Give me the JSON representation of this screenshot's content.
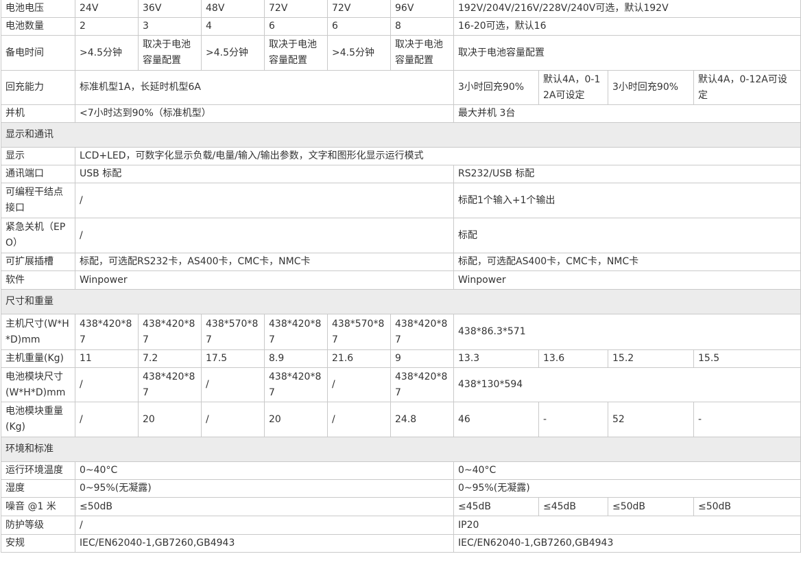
{
  "rows": [
    {
      "cells": [
        "电池电压",
        "24V",
        "36V",
        "48V",
        "72V",
        "72V",
        "96V",
        "192V/204V/216V/228V/240V可选，默认192V"
      ]
    },
    {
      "cells": [
        "电池数量",
        "2",
        "3",
        "4",
        "6",
        "6",
        "8",
        "16-20可选，默认16"
      ]
    },
    {
      "cells": [
        "备电时间",
        ">4.5分钟",
        "取决于电池容量配置",
        ">4.5分钟",
        "取决于电池容量配置",
        ">4.5分钟",
        "取决于电池容量配置",
        "取决于电池容量配置"
      ]
    },
    {
      "cells": [
        "回充能力",
        "标准机型1A，长延时机型6A",
        "3小时回充90%",
        "默认4A，0-12A可设定",
        "3小时回充90%",
        "默认4A，0-12A可设定"
      ]
    },
    {
      "cells": [
        "并机",
        "<7小时达到90%（标准机型）",
        "最大并机 3台"
      ]
    },
    {
      "cells": [
        "显示和通讯"
      ]
    },
    {
      "cells": [
        "显示",
        "LCD+LED，可数字化显示负载/电量/输入/输出参数，文字和图形化显示运行模式"
      ]
    },
    {
      "cells": [
        "通讯端口",
        "USB 标配",
        "RS232/USB 标配"
      ]
    },
    {
      "cells": [
        "可编程干结点接口",
        "/",
        "标配1个输入+1个输出"
      ]
    },
    {
      "cells": [
        "紧急关机（EPO）",
        "/",
        "标配"
      ]
    },
    {
      "cells": [
        "可扩展插槽",
        "标配，可选配RS232卡，AS400卡，CMC卡，NMC卡",
        "标配，可选配AS400卡，CMC卡，NMC卡"
      ]
    },
    {
      "cells": [
        "软件",
        "Winpower",
        "Winpower"
      ]
    },
    {
      "cells": [
        "尺寸和重量"
      ]
    },
    {
      "cells": [
        "主机尺寸(W*H*D)mm",
        "438*420*87",
        "438*420*87",
        "438*570*87",
        "438*420*87",
        "438*570*87",
        "438*420*87",
        "438*86.3*571"
      ]
    },
    {
      "cells": [
        "主机重量(Kg)",
        "11",
        "7.2",
        "17.5",
        "8.9",
        "21.6",
        "9",
        "13.3",
        "13.6",
        "15.2",
        "15.5"
      ]
    },
    {
      "cells": [
        "电池模块尺寸(W*H*D)mm",
        "/",
        "438*420*87",
        "/",
        "438*420*87",
        "/",
        "438*420*87",
        "438*130*594"
      ]
    },
    {
      "cells": [
        "电池模块重量(Kg)",
        "/",
        "20",
        "/",
        "20",
        "/",
        "24.8",
        "46",
        "-",
        "52",
        "-"
      ]
    },
    {
      "cells": [
        "环境和标准"
      ]
    },
    {
      "cells": [
        "运行环境温度",
        "0~40°C",
        "0~40°C"
      ]
    },
    {
      "cells": [
        "湿度",
        "0~95%(无凝露)",
        "0~95%(无凝露)"
      ]
    },
    {
      "cells": [
        "噪音 @1 米",
        "≤50dB",
        "≤45dB",
        "≤45dB",
        "≤50dB",
        "≤50dB"
      ]
    },
    {
      "cells": [
        "防护等级",
        "/",
        "IP20"
      ]
    },
    {
      "cells": [
        "安规",
        "IEC/EN62040-1,GB7260,GB4943",
        "IEC/EN62040-1,GB7260,GB4943"
      ]
    }
  ]
}
